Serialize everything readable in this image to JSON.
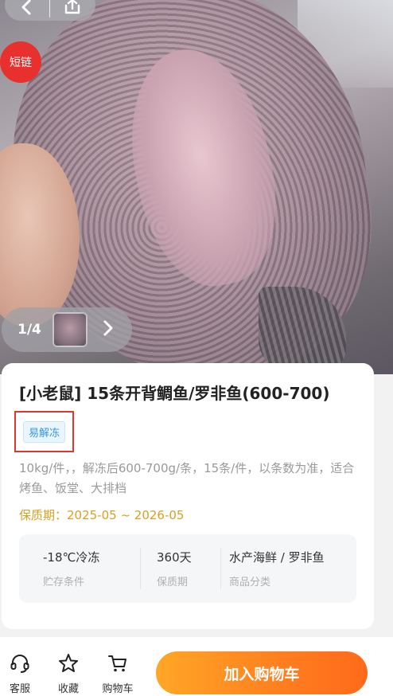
{
  "badge": {
    "short_chain": "短链"
  },
  "gallery": {
    "counter": "1/4"
  },
  "product": {
    "title": "[小老鼠] 15条开背鲷鱼/罗非鱼(600-700)",
    "tag": "易解冻",
    "description": "10kg/件，，解冻后600-700g/条，15条/件，以条数为准，适合烤鱼、饭堂、大排档",
    "shelf_life": "保质期：2025-05 ~ 2026-05"
  },
  "specs": [
    {
      "value": "-18℃冷冻",
      "label": "贮存条件"
    },
    {
      "value": "360天",
      "label": "保质期"
    },
    {
      "value": "水产海鲜 / 罗非鱼",
      "label": "商品分类"
    }
  ],
  "bottom_bar": {
    "service": "客服",
    "favorite": "收藏",
    "cart": "购物车",
    "add_to_cart": "加入购物车"
  },
  "colors": {
    "accent_orange": "#ff7e1f",
    "badge_red": "#e8302f",
    "shelf_gold": "#d9a021",
    "tag_blue": "#3a96d6"
  },
  "icons": [
    "back-arrow-icon",
    "share-icon",
    "chevron-right-icon",
    "headset-icon",
    "star-icon",
    "cart-icon"
  ]
}
